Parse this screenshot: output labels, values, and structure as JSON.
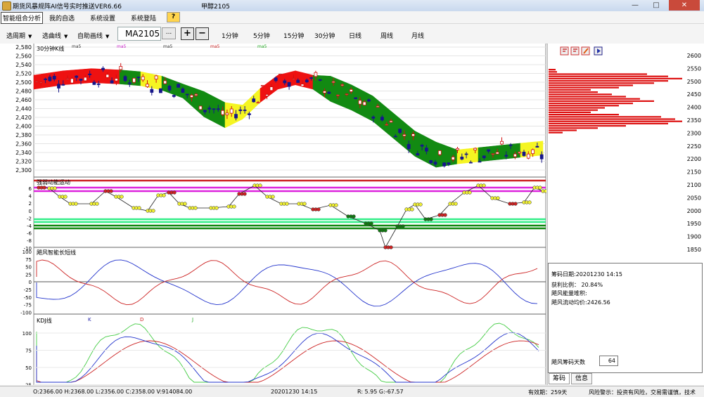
{
  "window": {
    "title": "期货风暴规阵AI信号实时推送VER6.66",
    "center_title": "甲醇2105",
    "controls": [
      "—",
      "□",
      "✕"
    ]
  },
  "menu": {
    "items": [
      "智能组合分析",
      "我的自选",
      "系统设置",
      "系统登陆"
    ],
    "help": "?"
  },
  "toolbar": {
    "period": "选周期",
    "curve": "选曲线",
    "auto_draw": "自助画线",
    "symbol": "MA2105",
    "more": "...",
    "plus": "+",
    "minus": "−",
    "timeframes": [
      "1分钟",
      "5分钟",
      "15分钟",
      "30分钟",
      "日线",
      "周线",
      "月线"
    ]
  },
  "chart": {
    "main_title": "30分钟K线",
    "ma_labels": [
      "ma5",
      "ma5",
      "ma5",
      "ma5",
      "ma5"
    ],
    "price_axis": [
      "2,580",
      "2,560",
      "2,540",
      "2,520",
      "2,500",
      "2,480",
      "2,460",
      "2,440",
      "2,420",
      "2,400",
      "2,380",
      "2,360",
      "2,340",
      "2,320",
      "2,300"
    ],
    "osc_title": "强弱动能运动",
    "osc_axis": [
      "6",
      "4",
      "2",
      "0",
      "-2",
      "-4",
      "-6",
      "-8",
      "-10"
    ],
    "long_short_title": "飓风智能长短线",
    "ls_axis": [
      "100",
      "75",
      "50",
      "25",
      "0",
      "-25",
      "-50",
      "-75",
      "-100"
    ],
    "kdj_title": "KDJ线",
    "kdj_labels": [
      "K",
      "D",
      "J"
    ],
    "kdj_axis": [
      "100",
      "75",
      "50",
      "25"
    ],
    "colors": {
      "up": "#d01010",
      "down": "#16168a",
      "band_red": "#ee1111",
      "band_green": "#128a12",
      "band_yellow": "#f5f522",
      "magenta": "#dd22dd",
      "bright_green": "#33ee88"
    }
  },
  "right_panel": {
    "toolbar_icons": [
      "chip-icon-1",
      "chip-icon-2",
      "pencil-icon",
      "play-icon"
    ],
    "price_axis": [
      "2600",
      "2550",
      "2500",
      "2450",
      "2400",
      "2350",
      "2300",
      "2250",
      "2200",
      "2150",
      "2100",
      "2050",
      "2000",
      "1950",
      "1900",
      "1850"
    ],
    "info": {
      "date": "筹码日期:20201230 14:15",
      "profit_ratio": "获利比例： 20.84%",
      "energy": "飓风能量堆积:",
      "flow": "飓风流动均价:2426.56"
    },
    "days_label": "飓风筹码天数",
    "days_value": "64",
    "tabs": [
      "筹码",
      "信息"
    ]
  },
  "status": {
    "ohlc": "O:2366.00  H:2368.00  L:2356.00  C:2358.00  V:914084.00",
    "time": "20201230 14:15",
    "rg": "R:  5.95  G:-67.57",
    "valid": "有效期：259天",
    "risk": "风险警示：投资有风险，交易需谨慎，技术"
  }
}
